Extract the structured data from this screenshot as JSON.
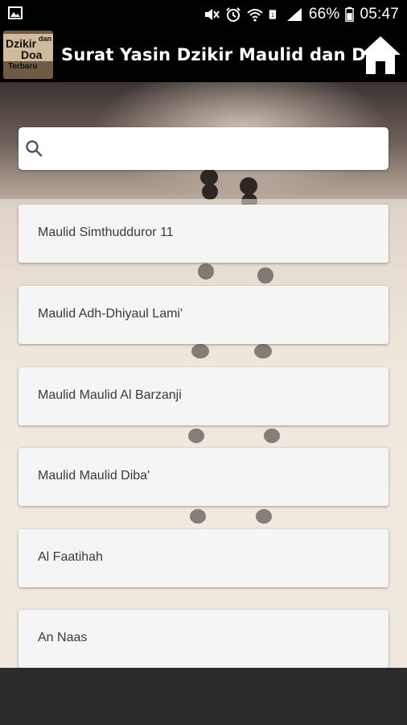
{
  "status_bar": {
    "battery_percent": "66%",
    "time": "05:47",
    "sim_badge": "1",
    "icons": [
      "image-icon",
      "mute-icon",
      "alarm-icon",
      "wifi-icon",
      "sim-icon",
      "signal-icon",
      "battery-icon"
    ]
  },
  "header": {
    "app_title": "Surat Yasin Dzikir Maulid dan Doa",
    "logo": {
      "line1": "Dzikir",
      "line1b": "dan",
      "line2": "Doa",
      "line3": "Terbaru"
    },
    "home_icon": "home-icon"
  },
  "search": {
    "placeholder": "",
    "value": "",
    "icon": "search-icon"
  },
  "items": [
    {
      "label": "Maulid Simthudduror 11"
    },
    {
      "label": "Maulid Adh-Dhiyaul Lami'"
    },
    {
      "label": "Maulid Maulid Al Barzanji"
    },
    {
      "label": "Maulid Maulid Diba'"
    },
    {
      "label": "Al Faatihah"
    },
    {
      "label": "An Naas"
    }
  ],
  "colors": {
    "header_bg": "#000000",
    "card_bg": "#f5f5f5",
    "bottom_bg": "#2b2b2b"
  }
}
